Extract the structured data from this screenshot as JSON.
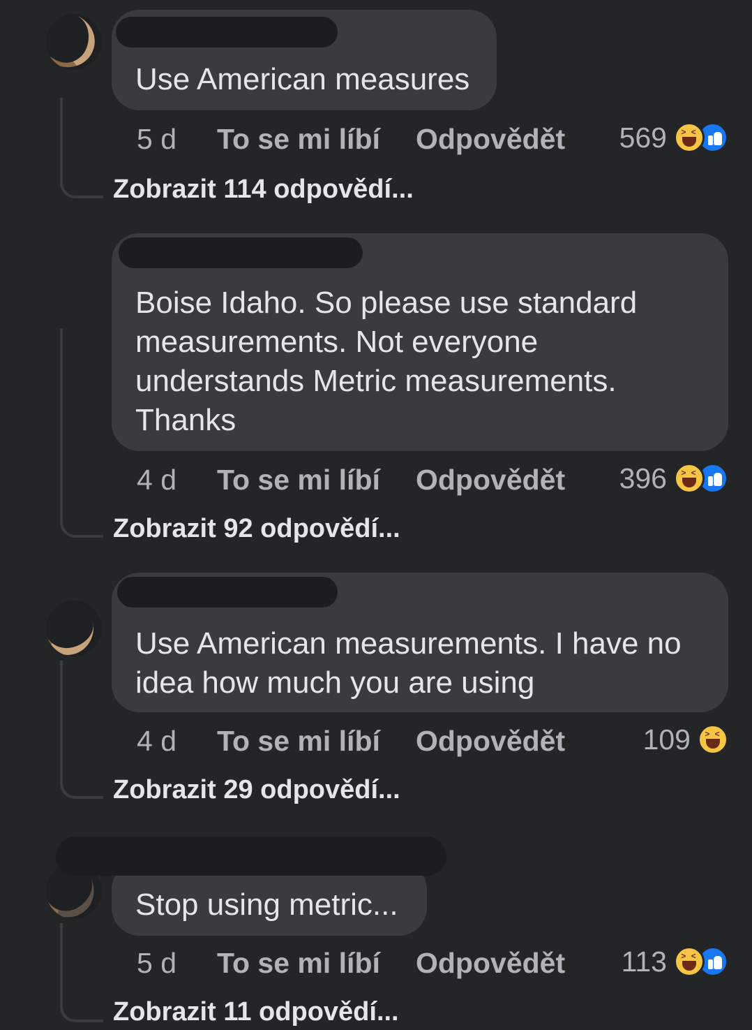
{
  "comments": [
    {
      "text": "Use American measures",
      "time": "5 d",
      "like_label": "To se mi líbí",
      "reply_label": "Odpovědět",
      "reaction_count": "569",
      "reactions": [
        "haha-icon",
        "like-icon"
      ],
      "view_replies": "Zobrazit 114 odpovědí..."
    },
    {
      "text": "Boise Idaho. So please use standard\nmeasurements. Not everyone\nunderstands Metric measurements.\nThanks",
      "time": "4 d",
      "like_label": "To se mi líbí",
      "reply_label": "Odpovědět",
      "reaction_count": "396",
      "reactions": [
        "haha-icon",
        "like-icon"
      ],
      "view_replies": "Zobrazit 92 odpovědí..."
    },
    {
      "text": "Use American measurements. I have no\nidea how much you are using",
      "time": "4 d",
      "like_label": "To se mi líbí",
      "reply_label": "Odpovědět",
      "reaction_count": "109",
      "reactions": [
        "haha-icon"
      ],
      "view_replies": "Zobrazit 29 odpovědí..."
    },
    {
      "text": "Stop using metric...",
      "time": "5 d",
      "like_label": "To se mi líbí",
      "reply_label": "Odpovědět",
      "reaction_count": "113",
      "reactions": [
        "haha-icon",
        "like-icon"
      ],
      "view_replies": "Zobrazit 11 odpovědí..."
    }
  ]
}
